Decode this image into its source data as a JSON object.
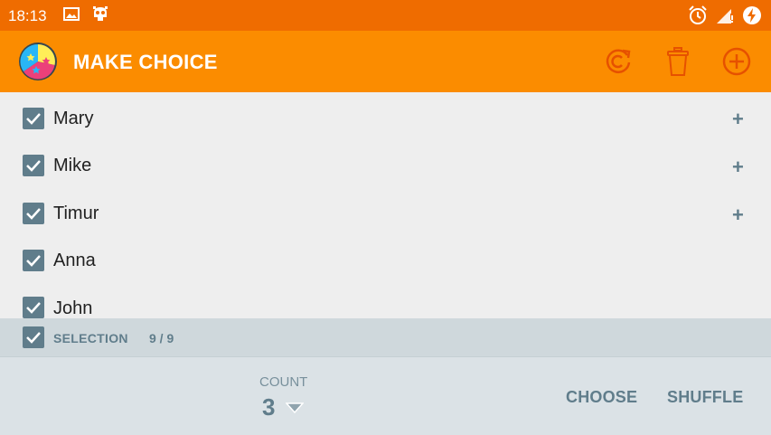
{
  "status_bar": {
    "time": "18:13"
  },
  "app_bar": {
    "title": "MAKE CHOICE",
    "actions": [
      "refresh-icon",
      "trash-icon",
      "add-circle-icon"
    ],
    "accent": "#fb8c00",
    "status_color": "#ef6c00"
  },
  "items": [
    {
      "name": "Mary",
      "checked": true,
      "has_plus": true
    },
    {
      "name": "Mike",
      "checked": true,
      "has_plus": true
    },
    {
      "name": "Timur",
      "checked": true,
      "has_plus": true
    },
    {
      "name": "Anna",
      "checked": true,
      "has_plus": false
    },
    {
      "name": "John",
      "checked": true,
      "has_plus": false
    }
  ],
  "selection": {
    "label": "SELECTION",
    "count": "9 / 9",
    "checked": true
  },
  "bottom": {
    "count_label": "COUNT",
    "count_value": "3",
    "choose_label": "CHOOSE",
    "shuffle_label": "SHUFFLE"
  },
  "plus_symbol": "+",
  "checkbox_color": "#607d8b"
}
